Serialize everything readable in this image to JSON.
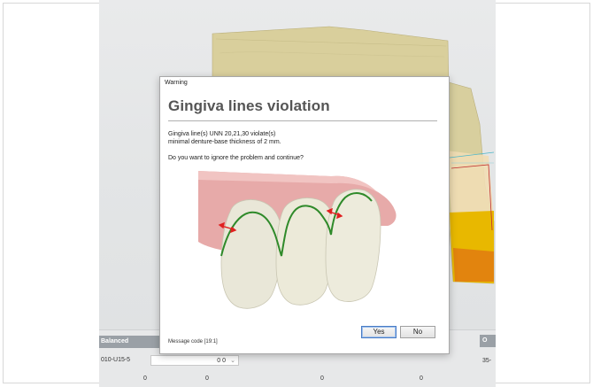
{
  "dialog": {
    "window_title": "Warning",
    "heading": "Gingiva lines violation",
    "message_line1": "Gingiva line(s) UNN 20,21,30 violate(s)",
    "message_line2": "minimal denture-base thickness of 2 mm.",
    "question": "Do you want to ignore the problem and continue?",
    "yes_label": "Yes",
    "no_label": "No",
    "message_code": "Message code [19:1]"
  },
  "bottom_panel": {
    "header_label": "Balanced",
    "tooth_code": "010-U15-5",
    "select_value": "0 0",
    "row_values": [
      "0",
      "0",
      "0",
      "0"
    ],
    "right_header": "O",
    "right_code": "35-"
  },
  "colors": {
    "dialog_heading": "#555555",
    "gingiva": "#e6a8a8",
    "tooth": "#e8e6d6",
    "gingiva_line": "#2f8a2a",
    "violation_arrow": "#e02020",
    "model_yellow": "#e8b800",
    "model_beige": "#d8cf9e"
  }
}
